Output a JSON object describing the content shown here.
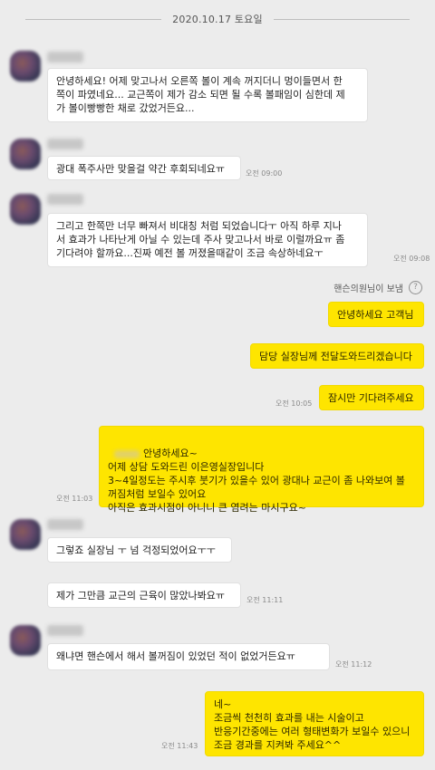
{
  "date_divider": "2020.10.17 토요일",
  "sender_note": "핸슨의원님이 보냄",
  "sender_note_icon": "question-circle-icon",
  "messages": [
    {
      "text": "안녕하세요! 어제 맞고나서 오른쪽 볼이 계속 꺼지더니 멍이들면서 한\n쪽이 파였네요... 교근쪽이 제가 감소 되면 될 수록 볼패임이 심한데 제\n가 볼이빵빵한 채로 갔었거든요...",
      "time": ""
    },
    {
      "text": "광대 폭주사만 맞을걸 약간 후회되네요ㅠ",
      "time": "오전 09:00"
    },
    {
      "text": "그리고 한쪽만 너무 빠져서 비대칭 처럼 되었습니다ㅜ 아직 하루 지나\n서 효과가 나타난게 아닐 수 있는데 주사 맞고나서 바로 이럴까요ㅠ 좀\n기다려야 할까요...진짜 예전 볼 꺼졌을때같이 조금 속상하네요ㅜ",
      "time": "오전 09:08"
    },
    {
      "text": "안녕하세요 고객님",
      "time": ""
    },
    {
      "text": "담당 실장님께 전달도와드리겠습니다",
      "time": ""
    },
    {
      "text": "잠시만 기다려주세요",
      "time": "오전 10:05"
    },
    {
      "text": "안녕하세요~\n어제 상담 도와드린 이은영실장입니다\n3~4일정도는 주시후 붓기가 있을수 있어 광대나 교근이 좀 나와보여 볼\n꺼짐처럼 보일수 있어요\n아직은 효과시점이 아니니 큰 염려는 마시구요~",
      "time": "오전 11:03"
    },
    {
      "text": "그렇죠 실장님 ㅜ 넘 걱정되었어요ㅜㅜ",
      "time": ""
    },
    {
      "text": "제가 그만큼 교근의 근육이 많았나봐요ㅠ",
      "time": "오전 11:11"
    },
    {
      "text": "왜냐면 핸슨에서 해서 볼꺼짐이 있었던 적이 없었거든요ㅠ",
      "time": "오전 11:12"
    },
    {
      "text": "네~\n조금씩 천천히 효과를 내는 시술이고\n반응기간중에는 여러 형태변화가 보일수 있으니\n조금 경과를 지켜봐 주세요^^",
      "time": "오전 11:43"
    }
  ]
}
